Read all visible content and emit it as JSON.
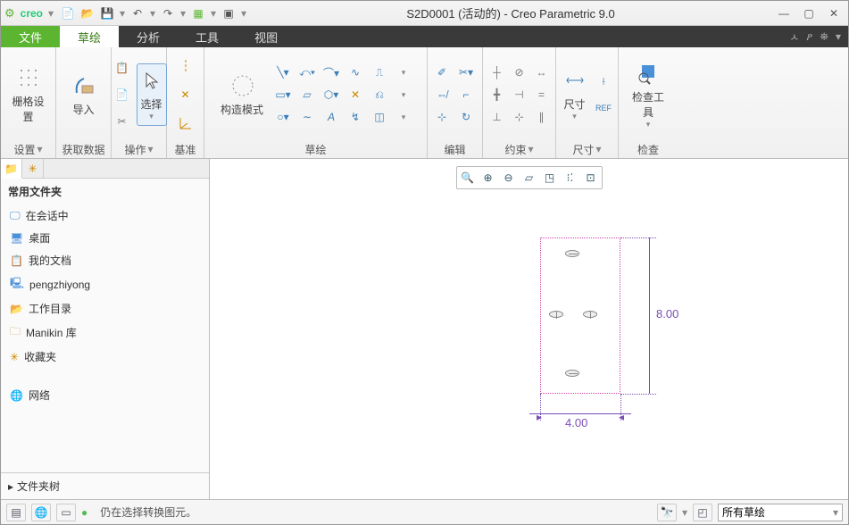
{
  "title": "S2D0001 (活动的) - Creo Parametric 9.0",
  "brand": "creo",
  "tabs": {
    "file": "文件",
    "sketch": "草绘",
    "analysis": "分析",
    "tools": "工具",
    "view": "视图"
  },
  "ribbon": {
    "grid": {
      "label": "栅格设置",
      "sub": "设置"
    },
    "import": {
      "label": "导入",
      "sub": "获取数据"
    },
    "select": {
      "label": "选择",
      "sub": "操作"
    },
    "datum": {
      "sub": "基准"
    },
    "construct": {
      "label": "构造模式",
      "sub": "草绘"
    },
    "edit": {
      "sub": "编辑"
    },
    "constrain": {
      "sub": "约束"
    },
    "dim": {
      "label": "尺寸",
      "sub": "尺寸"
    },
    "inspect": {
      "label": "检查工具",
      "sub": "检查"
    }
  },
  "sidebar": {
    "head": "常用文件夹",
    "items": [
      "在会话中",
      "桌面",
      "我的文档",
      "pengzhiyong",
      "工作目录",
      "Manikin 库",
      "收藏夹",
      "网络"
    ],
    "tree": "文件夹树"
  },
  "dims": {
    "h": "8.00",
    "w": "4.00"
  },
  "status": {
    "msg": "仍在选择转换图元。",
    "combo": "所有草绘"
  }
}
